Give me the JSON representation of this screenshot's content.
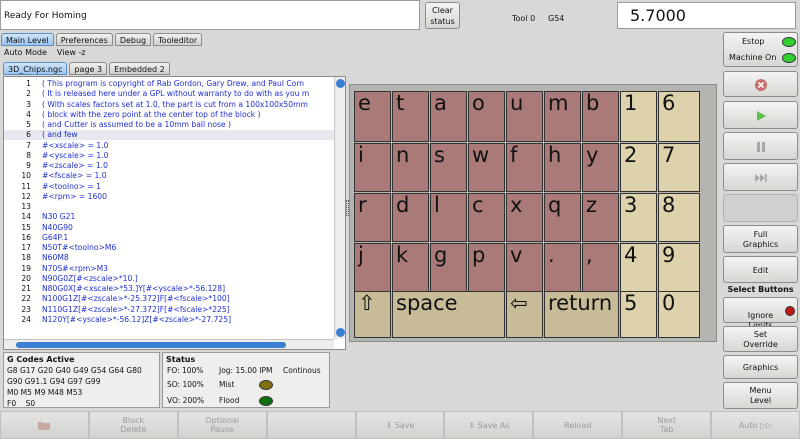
{
  "header": {
    "status_text": "Ready For Homing",
    "clear_status": "Clear\nstatus",
    "tool": "Tool 0",
    "coord_system": "G54",
    "dro_value": "5.7000"
  },
  "main_tabs": [
    "Main Level",
    "Preferences",
    "Debug",
    "Tooleditor"
  ],
  "menu": [
    "Auto Mode",
    "View -z"
  ],
  "file_tabs": [
    "3D_Chips.ngc",
    "page 3",
    "Embedded 2"
  ],
  "code_lines": [
    {
      "n": "1",
      "t": "( This program is copyright of Rab Gordon, Gary Drew, and Paul Corn"
    },
    {
      "n": "2",
      "t": "( It is released here under a GPL without warranty to do with as you m"
    },
    {
      "n": "3",
      "t": "( With scales factors set at 1.0, the part is cut from a 100x100x50mm"
    },
    {
      "n": "4",
      "t": "( block with the zero point at the center top of the block )"
    },
    {
      "n": "5",
      "t": "( and Cutter is assumed to be a 10mm ball nose )"
    },
    {
      "n": "6",
      "t": "( and few"
    },
    {
      "n": "7",
      "t": "#<xscale> = 1.0"
    },
    {
      "n": "8",
      "t": "#<yscale> = 1.0"
    },
    {
      "n": "9",
      "t": "#<zscale> = 1.0"
    },
    {
      "n": "10",
      "t": "#<fscale> = 1.0"
    },
    {
      "n": "11",
      "t": "#<toolno> = 1"
    },
    {
      "n": "12",
      "t": "#<rpm>    = 1600"
    },
    {
      "n": "13",
      "t": ""
    },
    {
      "n": "14",
      "t": "N30 G21"
    },
    {
      "n": "15",
      "t": "N40G90"
    },
    {
      "n": "16",
      "t": "G64P.1"
    },
    {
      "n": "17",
      "t": "N50T#<toolno>M6"
    },
    {
      "n": "18",
      "t": "N60M8"
    },
    {
      "n": "19",
      "t": "N70S#<rpm>M3"
    },
    {
      "n": "20",
      "t": "N90G0Z[#<zscale>*10.]"
    },
    {
      "n": "21",
      "t": "N80G0X[#<xscale>*53.]Y[#<yscale>*-56.128]"
    },
    {
      "n": "22",
      "t": "N100G1Z[#<zscale>*-25.372]F[#<fscale>*100]"
    },
    {
      "n": "23",
      "t": "N110G1Z[#<zscale>*-27.372]F[#<fscale>*225]"
    },
    {
      "n": "24",
      "t": "N120Y[#<yscale>*-56.12]Z[#<zscale>*-27.725]"
    }
  ],
  "keyboard": {
    "rows": [
      [
        "e",
        "t",
        "a",
        "o",
        "u",
        "m",
        "b",
        "1",
        "6"
      ],
      [
        "i",
        "n",
        "s",
        "w",
        "f",
        "h",
        "y",
        "2",
        "7"
      ],
      [
        "r",
        "d",
        "l",
        "c",
        "x",
        "q",
        "z",
        "3",
        "8"
      ],
      [
        "j",
        "k",
        "g",
        "p",
        "v",
        ".",
        ",",
        "4",
        "9"
      ]
    ],
    "bottom": [
      "⇧",
      "space",
      "⇦",
      "return",
      "5",
      "0"
    ]
  },
  "side": {
    "estop": "Estop",
    "machine_on": "Machine On",
    "full_graphics": "Full\nGraphics",
    "edit": "Edit",
    "select_buttons": "Select Buttons",
    "ignore_limits": "Ignore\nLimits",
    "set_override": "Set\nOverride",
    "graphics": "Graphics",
    "menu_level": "Menu\nLevel"
  },
  "gcodes": {
    "title": "G Codes Active",
    "lines": [
      "G8 G17 G20 G40 G49 G54 G64 G80",
      "G90 G91.1 G94 G97 G99",
      "M0 M5 M9 M48 M53",
      "F0    S0"
    ]
  },
  "status": {
    "title": "Status",
    "fo": "FO: 100%",
    "jog": "Jog: 15.00 IPM",
    "mode": "Continous",
    "so": "SO: 100%",
    "mist": "Mist",
    "vo": "VO: 200%",
    "flood": "Flood"
  },
  "footer": [
    "",
    "Block\nDelete",
    "Optional\nPause",
    "",
    "Save",
    "Save As",
    "Reload",
    "Next\nTab",
    "Auto"
  ],
  "colors": {
    "led_green": "#2fd02f",
    "led_red": "#c01818",
    "mist_led": "#807010",
    "flood_led": "#107010"
  }
}
